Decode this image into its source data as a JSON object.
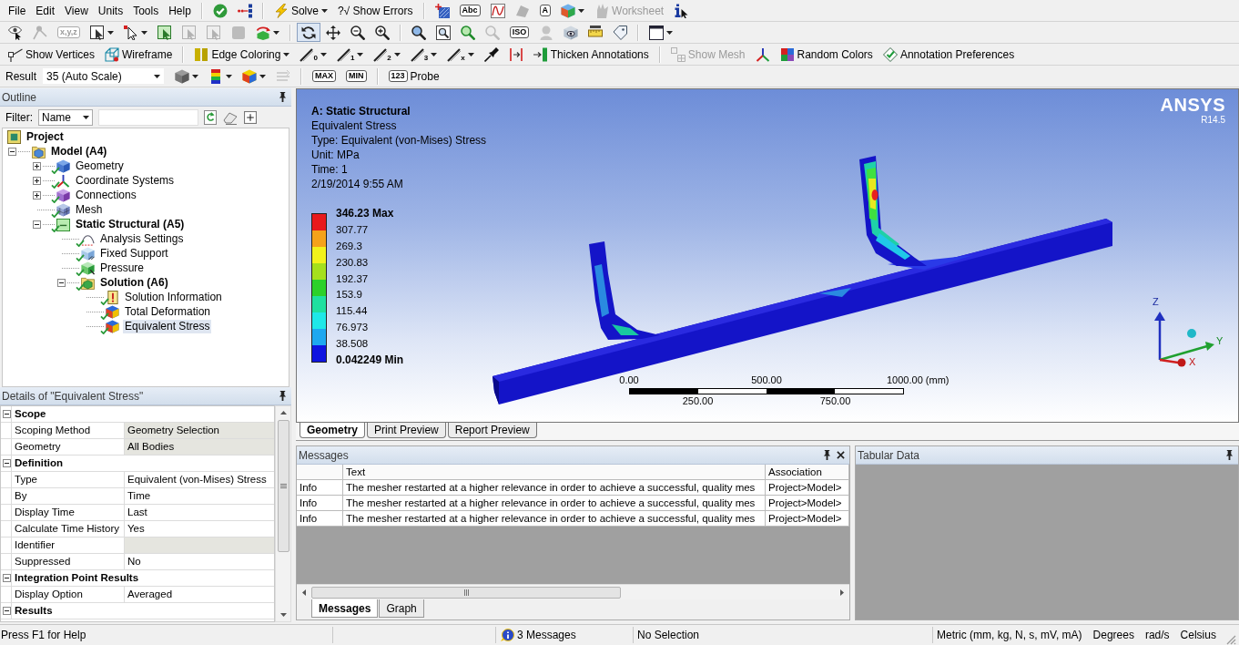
{
  "menu_bar": {
    "items": [
      "File",
      "Edit",
      "View",
      "Units",
      "Tools",
      "Help"
    ]
  },
  "toolbars": [
    {
      "groups": [
        {
          "items": [
            {
              "kind": "button",
              "disabled": false
            },
            {
              "kind": "button",
              "disabled": false
            }
          ]
        },
        {
          "items": [
            {
              "kind": "button",
              "label": "Solve",
              "caret": true,
              "disabled": false
            },
            {
              "kind": "button",
              "label": "?√ Show Errors",
              "disabled": false
            }
          ]
        },
        {
          "items": [
            {
              "kind": "button",
              "disabled": false
            },
            {
              "kind": "button",
              "glyph": "Abc",
              "disabled": false
            },
            {
              "kind": "button",
              "disabled": false
            },
            {
              "kind": "button",
              "disabled": true
            },
            {
              "kind": "button",
              "glyph": "A",
              "disabled": false
            },
            {
              "kind": "button",
              "caret": true,
              "disabled": false
            },
            {
              "kind": "button",
              "label": "Worksheet",
              "disabled": true
            },
            {
              "kind": "button",
              "disabled": false
            }
          ]
        }
      ]
    },
    {
      "groups": [
        {
          "items": [
            {
              "kind": "button",
              "disabled": false
            },
            {
              "kind": "button",
              "disabled": true
            },
            {
              "kind": "button",
              "glyph": "x,y,z",
              "disabled": true
            },
            {
              "kind": "button",
              "caret": true,
              "disabled": false
            },
            {
              "kind": "button",
              "caret": true,
              "disabled": false
            },
            {
              "kind": "button",
              "disabled": false
            },
            {
              "kind": "button",
              "disabled": true
            },
            {
              "kind": "button",
              "disabled": true
            },
            {
              "kind": "button",
              "disabled": true
            },
            {
              "kind": "button",
              "caret": true,
              "disabled": false
            }
          ]
        },
        {
          "items": [
            {
              "kind": "button",
              "disabled": false,
              "selected": true
            },
            {
              "kind": "button",
              "disabled": false,
              "selected": false
            },
            {
              "kind": "button",
              "disabled": false,
              "selected": false
            },
            {
              "kind": "button",
              "disabled": false,
              "selected": false
            }
          ]
        },
        {
          "items": [
            {
              "kind": "button",
              "disabled": false
            },
            {
              "kind": "button",
              "disabled": false
            },
            {
              "kind": "button",
              "disabled": false
            },
            {
              "kind": "button",
              "disabled": true
            },
            {
              "kind": "button",
              "glyph": "ISO",
              "disabled": false
            },
            {
              "kind": "button",
              "disabled": true
            },
            {
              "kind": "button",
              "disabled": false
            },
            {
              "kind": "button",
              "disabled": false
            },
            {
              "kind": "button",
              "disabled": false
            }
          ]
        },
        {
          "items": [
            {
              "kind": "button",
              "caret": true,
              "disabled": false
            }
          ]
        }
      ]
    },
    {
      "groups": [
        {
          "items": [
            {
              "kind": "button",
              "label": "Show Vertices",
              "disabled": false
            },
            {
              "kind": "button",
              "label": "Wireframe",
              "disabled": false
            }
          ]
        },
        {
          "items": [
            {
              "kind": "button",
              "label": "Edge Coloring",
              "caret": true,
              "disabled": false
            },
            {
              "kind": "button",
              "glyph": "0",
              "caret": true,
              "disabled": false
            },
            {
              "kind": "button",
              "glyph": "1",
              "caret": true,
              "disabled": false
            },
            {
              "kind": "button",
              "glyph": "2",
              "caret": true,
              "disabled": false
            },
            {
              "kind": "button",
              "glyph": "3",
              "caret": true,
              "disabled": false
            },
            {
              "kind": "button",
              "glyph": "x",
              "caret": true,
              "disabled": false
            },
            {
              "kind": "button",
              "disabled": false
            },
            {
              "kind": "button",
              "disabled": false
            },
            {
              "kind": "button",
              "label": "Thicken Annotations",
              "disabled": false
            }
          ]
        },
        {
          "items": [
            {
              "kind": "button",
              "label": "Show Mesh",
              "disabled": true
            },
            {
              "kind": "button",
              "disabled": false
            },
            {
              "kind": "button",
              "label": "Random Colors",
              "disabled": false
            },
            {
              "kind": "button",
              "label": "Annotation Preferences",
              "disabled": false
            }
          ]
        }
      ]
    },
    {
      "groups": [
        {
          "items": [
            {
              "kind": "label",
              "label": "Result",
              "disabled": false
            },
            {
              "kind": "select",
              "value": "35 (Auto Scale)",
              "disabled": false
            },
            {
              "kind": "button",
              "caret": true,
              "disabled": false
            },
            {
              "kind": "button",
              "caret": true,
              "disabled": false
            },
            {
              "kind": "button",
              "caret": true,
              "disabled": false
            },
            {
              "kind": "button",
              "disabled": true
            }
          ]
        },
        {
          "items": [
            {
              "kind": "button",
              "glyph": "MAX",
              "disabled": false
            },
            {
              "kind": "button",
              "glyph": "MIN",
              "disabled": false
            }
          ]
        },
        {
          "items": [
            {
              "kind": "button",
              "glyph": "123",
              "label": "Probe",
              "disabled": false
            }
          ]
        }
      ]
    }
  ],
  "outline": {
    "title": "Outline",
    "filter": {
      "label": "Filter:",
      "mode": "Name"
    },
    "tree": [
      {
        "label": "Project",
        "kind": "project",
        "bold": true,
        "solved": false,
        "selected": false,
        "children": [
          {
            "label": "Model (A4)",
            "kind": "model",
            "bold": true,
            "expanded": true,
            "solved": false,
            "selected": false,
            "children": [
              {
                "label": "Geometry",
                "kind": "geometry",
                "bold": false,
                "expanded": false,
                "solved": true,
                "selected": false
              },
              {
                "label": "Coordinate Systems",
                "kind": "coordinates",
                "bold": false,
                "expanded": false,
                "solved": true,
                "selected": false
              },
              {
                "label": "Connections",
                "kind": "connections",
                "bold": false,
                "expanded": false,
                "solved": true,
                "selected": false
              },
              {
                "label": "Mesh",
                "kind": "mesh",
                "bold": false,
                "solved": true,
                "selected": false
              },
              {
                "label": "Static Structural (A5)",
                "kind": "analysis",
                "bold": true,
                "expanded": true,
                "solved": true,
                "selected": false,
                "children": [
                  {
                    "label": "Analysis Settings",
                    "kind": "settings",
                    "bold": false,
                    "solved": true,
                    "selected": false
                  },
                  {
                    "label": "Fixed Support",
                    "kind": "support",
                    "bold": false,
                    "solved": true,
                    "selected": false
                  },
                  {
                    "label": "Pressure",
                    "kind": "pressure",
                    "bold": false,
                    "solved": true,
                    "selected": false
                  },
                  {
                    "label": "Solution (A6)",
                    "kind": "solution",
                    "bold": true,
                    "expanded": true,
                    "solved": true,
                    "selected": false,
                    "children": [
                      {
                        "label": "Solution Information",
                        "kind": "information",
                        "bold": false,
                        "solved": true,
                        "selected": false
                      },
                      {
                        "label": "Total Deformation",
                        "kind": "result",
                        "bold": false,
                        "solved": true,
                        "selected": false
                      },
                      {
                        "label": "Equivalent Stress",
                        "kind": "result",
                        "bold": false,
                        "solved": true,
                        "selected": true
                      }
                    ]
                  }
                ]
              }
            ]
          }
        ]
      }
    ]
  },
  "details": {
    "title": "Details of \"Equivalent Stress\"",
    "groups": [
      {
        "title": "Scope",
        "expanded": true,
        "rows": [
          {
            "label": "Scoping Method",
            "value": "Geometry Selection",
            "shaded": true
          },
          {
            "label": "Geometry",
            "value": "All Bodies",
            "shaded": true
          }
        ]
      },
      {
        "title": "Definition",
        "expanded": true,
        "rows": [
          {
            "label": "Type",
            "value": "Equivalent (von-Mises) Stress",
            "shaded": false
          },
          {
            "label": "By",
            "value": "Time",
            "shaded": false
          },
          {
            "label": "Display Time",
            "value": "Last",
            "shaded": false
          },
          {
            "label": "Calculate Time History",
            "value": "Yes",
            "shaded": false
          },
          {
            "label": "Identifier",
            "shaded": true
          },
          {
            "label": "Suppressed",
            "value": "No",
            "shaded": false
          }
        ]
      },
      {
        "title": "Integration Point Results",
        "expanded": true,
        "rows": [
          {
            "label": "Display Option",
            "value": "Averaged",
            "shaded": false
          }
        ]
      },
      {
        "title": "Results",
        "expanded": true
      }
    ]
  },
  "viewport": {
    "header": {
      "title": "A: Static Structural",
      "lines": [
        "Equivalent Stress",
        "Type: Equivalent (von-Mises) Stress",
        "Unit: MPa",
        "Time: 1",
        "2/19/2014 9:55 AM"
      ]
    },
    "legend": {
      "labels": [
        "346.23 Max",
        "307.77",
        "269.3",
        "230.83",
        "192.37",
        "153.9",
        "115.44",
        "76.973",
        "38.508",
        "0.042249 Min"
      ],
      "bands": [
        {
          "color": "#e8191c"
        },
        {
          "color": "#f5a21a"
        },
        {
          "color": "#f2f21c"
        },
        {
          "color": "#a5e01c"
        },
        {
          "color": "#2cd12a"
        },
        {
          "color": "#1fe0a0"
        },
        {
          "color": "#1fe8e8"
        },
        {
          "color": "#1ea8f0"
        },
        {
          "color": "#0f14e0"
        }
      ]
    },
    "logo": {
      "name": "ANSYS",
      "version": "R14.5"
    },
    "scale_bar": {
      "top_labels": [
        "0.00",
        "500.00",
        "1000.00 (mm)"
      ],
      "bottom_labels": [
        "250.00",
        "750.00"
      ]
    },
    "triad": {
      "axes": [
        {
          "label": "Z"
        },
        {
          "label": "Y"
        },
        {
          "label": "X"
        }
      ]
    },
    "tabs": [
      {
        "label": "Geometry",
        "selected": true
      },
      {
        "label": "Print Preview",
        "selected": false
      },
      {
        "label": "Report Preview",
        "selected": false
      }
    ]
  },
  "messages": {
    "title": "Messages",
    "column_headings": [
      "Text",
      "Association"
    ],
    "rows": [
      {
        "column_1": "Info",
        "text": "The mesher restarted at a higher relevance in order to achieve a successful, quality mes",
        "association": "Project>Model>"
      },
      {
        "column_1": "Info",
        "text": "The mesher restarted at a higher relevance in order to achieve a successful, quality mes",
        "association": "Project>Model>"
      },
      {
        "column_1": "Info",
        "text": "The mesher restarted at a higher relevance in order to achieve a successful, quality mes",
        "association": "Project>Model>"
      }
    ],
    "tabs": [
      {
        "label": "Messages",
        "selected": true
      },
      {
        "label": "Graph",
        "selected": false
      }
    ]
  },
  "tabular_data": {
    "title": "Tabular Data"
  },
  "status_bar": {
    "help": "Press F1 for Help",
    "messages": "3 Messages",
    "selection": "No Selection",
    "units": [
      "Metric (mm, kg, N, s, mV, mA)",
      "Degrees",
      "rad/s",
      "Celsius"
    ]
  }
}
